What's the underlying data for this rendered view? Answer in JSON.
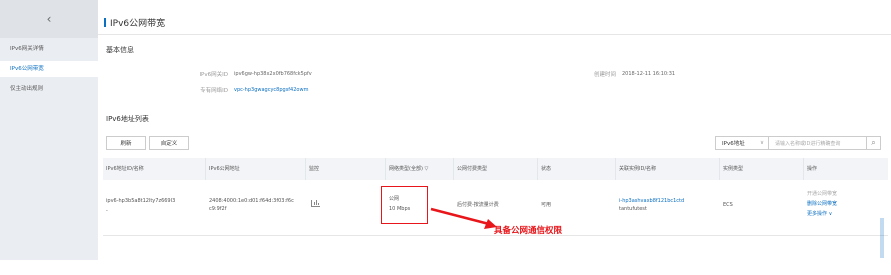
{
  "sidebar": {
    "back_icon": "chevron-left-icon",
    "back_glyph": "‹",
    "items": [
      {
        "label": "IPv6网关详情",
        "active": false
      },
      {
        "label": "IPv6公网带宽",
        "active": true
      },
      {
        "label": "仅主动出规则",
        "active": false
      }
    ]
  },
  "header": {
    "title": "IPv6公网带宽"
  },
  "basic_info": {
    "section_title": "基本信息",
    "gateway_id_label": "IPv6网关ID",
    "gateway_id_value": "ipv6gw-hp38x2x0fb768fck5pfv",
    "vpc_id_label": "专有网络ID",
    "vpc_id_value": "vpc-hp3gwagcyc8pgsf42owm",
    "created_label": "创建时间",
    "created_value": "2018-12-11 16:10:31"
  },
  "address_list": {
    "section_title": "IPv6地址列表",
    "refresh_label": "刷新",
    "custom_label": "自定义",
    "filter_select": "IPv6地址",
    "filter_placeholder": "请输入名称或ID进行精确查询",
    "search_icon": "search-icon"
  },
  "table": {
    "columns": [
      "IPv6地址ID/名称",
      "IPv6公网地址",
      "监控",
      "网络类型(全部) ▽",
      "公网付费类型",
      "状态",
      "关联实例ID/名称",
      "实例类型",
      "操作"
    ],
    "rows": [
      {
        "id_line1": "ipv6-hp3b5a8t12lty7z669I3",
        "id_line2": "-",
        "ip_line1": "2408:4000:1e0:d01:f64d:3f03:f6c",
        "ip_line2": "c9:9f2f",
        "network_line1": "公网",
        "network_line2": "10 Mbps",
        "billing": "后付费-按流量计费",
        "status": "可用",
        "instance_line1": "i-hp3ashvaxb8f121bc1ctd",
        "instance_line2": "tantufutest",
        "instance_type": "ECS",
        "op_open": "开通公网带宽",
        "op_delete": "删除公网带宽",
        "op_more": "更多操作 ∨"
      }
    ]
  },
  "annotation": {
    "text": "具备公网通信权限",
    "color": "#e8161b"
  },
  "colors": {
    "accent": "#0b6fc2",
    "sidebar_bg": "#eaedf1",
    "table_header_bg": "#f2f4f7"
  }
}
